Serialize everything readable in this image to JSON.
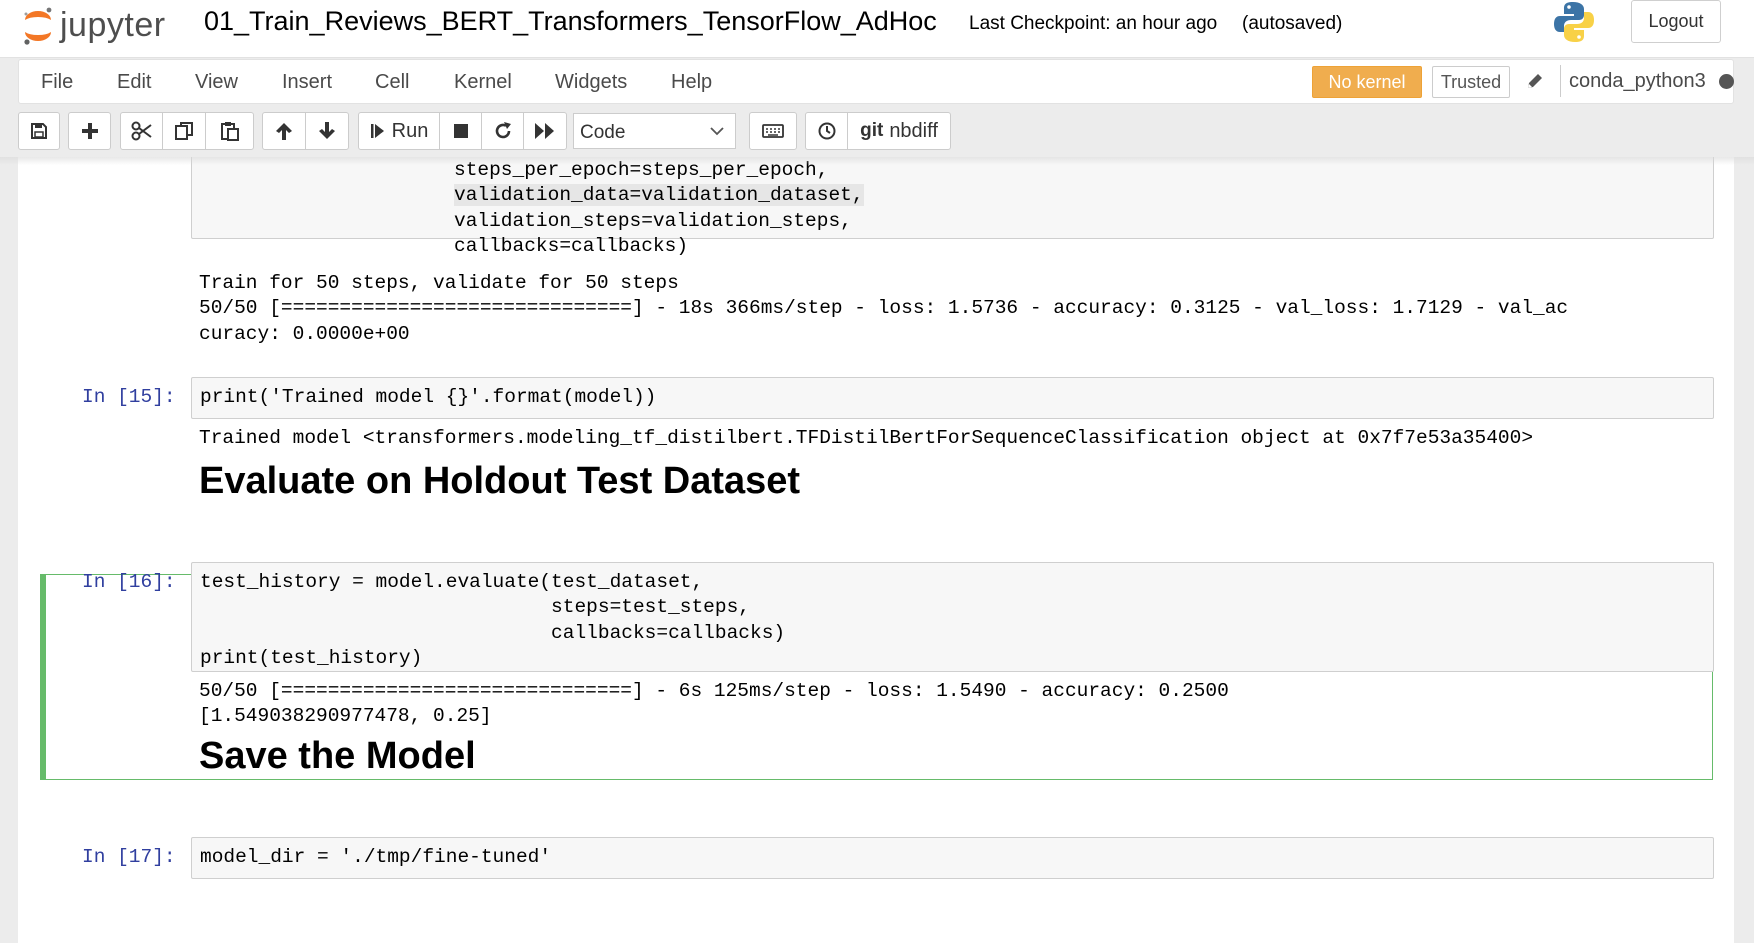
{
  "header": {
    "logo_text": "jupyter",
    "notebook_title": "01_Train_Reviews_BERT_Transformers_TensorFlow_AdHoc",
    "checkpoint": "Last Checkpoint: an hour ago",
    "autosave": "(autosaved)",
    "logout_label": "Logout"
  },
  "menubar": {
    "items": [
      "File",
      "Edit",
      "View",
      "Insert",
      "Cell",
      "Kernel",
      "Widgets",
      "Help"
    ],
    "kernel_status": "No kernel",
    "trusted": "Trusted",
    "kernel_name": "conda_python3"
  },
  "toolbar": {
    "run_label": "Run",
    "cell_type": "Code",
    "git_label": "git",
    "nbdiff_label": "nbdiff"
  },
  "cells": {
    "fit_cell": {
      "code_lines": [
        "steps_per_epoch=steps_per_epoch,",
        "validation_data=validation_dataset,",
        "validation_steps=validation_steps,",
        "callbacks=callbacks)"
      ],
      "output_lines": [
        "Train for 50 steps, validate for 50 steps",
        "50/50 [==============================] - 18s 366ms/step - loss: 1.5736 - accuracy: 0.3125 - val_loss: 1.7129 - val_ac",
        "curacy: 0.0000e+00"
      ]
    },
    "cell15": {
      "prompt": "In [15]:",
      "code": "print('Trained model {}'.format(model))",
      "output": "Trained model <transformers.modeling_tf_distilbert.TFDistilBertForSequenceClassification object at 0x7f7e53a35400>"
    },
    "heading1": "Evaluate on Holdout Test Dataset",
    "cell16": {
      "prompt": "In [16]:",
      "code_lines": [
        "test_history = model.evaluate(test_dataset,",
        "                              steps=test_steps,",
        "                              callbacks=callbacks)",
        "print(test_history)"
      ],
      "output_lines": [
        "50/50 [==============================] - 6s 125ms/step - loss: 1.5490 - accuracy: 0.2500",
        "[1.549038290977478, 0.25]"
      ]
    },
    "heading2": "Save the Model",
    "cell17": {
      "prompt": "In [17]:",
      "code": "model_dir = './tmp/fine-tuned'"
    }
  },
  "colors": {
    "accent_orange": "#f0ad4e",
    "prompt_blue": "#303f9f",
    "selected_green": "#66bb6a",
    "keyword_purple": "#aa22ff",
    "builtin_green": "#008000",
    "string_red": "#ba2121"
  }
}
